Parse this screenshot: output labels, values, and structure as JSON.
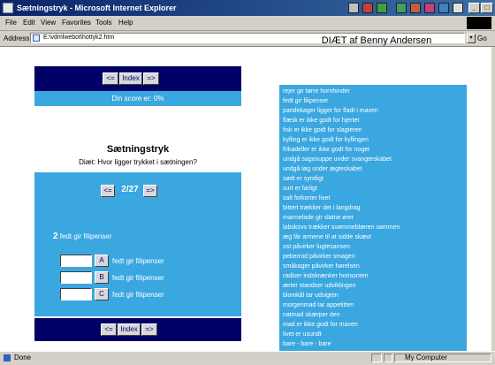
{
  "window": {
    "title": "Sætningstryk - Microsoft Internet Explorer",
    "minimize": "_",
    "maximize": "□",
    "close": "x"
  },
  "menu": [
    "File",
    "Edit",
    "View",
    "Favorites",
    "Tools",
    "Help"
  ],
  "address": {
    "label": "Address",
    "url": "E:\\vdmlwebot\\hottyk2.htm",
    "dropdown": "▾",
    "go": "Go"
  },
  "nav": {
    "prev": "<=",
    "index": "Index",
    "next": "=>"
  },
  "score_text": "Din score er: 0%",
  "exercise": {
    "title": "Sætningstryk",
    "subtitle": "Diæt: Hvor ligger trykket i sætningen?",
    "prev": "<=",
    "counter": "2/27",
    "next": "=>",
    "sentence_num": "2",
    "sentence": "fedt gir filipenser",
    "answers": [
      {
        "button": "A",
        "text": "fedt gir filipenser"
      },
      {
        "button": "B",
        "text": "fedt gir filipenser"
      },
      {
        "button": "C",
        "text": "fedt gir filipenser"
      }
    ]
  },
  "poem": {
    "title": "DIÆT af Benny Andersen",
    "lines": [
      "rejer gir tørre hornhinder",
      "fedt gir filipenser",
      "pandekager ligger for fladt i maven",
      "flæsk er ikke godt for hjertet",
      "fisk er ikke godt for slagteren",
      "kylling er ikke godt for kyllingen",
      "frikadeller er ikke godt for noget",
      "undgå sagosuppe under svangerskabet",
      "undgå løg under ægteskabet",
      "sødt er syndigt",
      "surt er farligt",
      "salt forkorter livet",
      "bittert trækker det i langdrag",
      "marmelade gir slatne ører",
      "labskovs trækker svømmeblæren sammen",
      "æg får armene til at sidde skævt",
      "ost påvirker lugtesansen",
      "peberrod påvirker smagen",
      "småkager påvirker hørelsen",
      "radiser indskrænker horisonten",
      "ærter standser udviklingen",
      "blomkål tar udsigten",
      "morgenmad tar appetitten",
      "natmad skærper den",
      "mad er ikke godt for maven",
      "livet er usundt",
      "bare - bare - bare"
    ]
  },
  "status": {
    "text": "Done",
    "zone": "My Computer"
  },
  "colors": {
    "panel_dark": "#000066",
    "panel_light": "#3aa7e0",
    "titlebar": "#0a246a"
  }
}
